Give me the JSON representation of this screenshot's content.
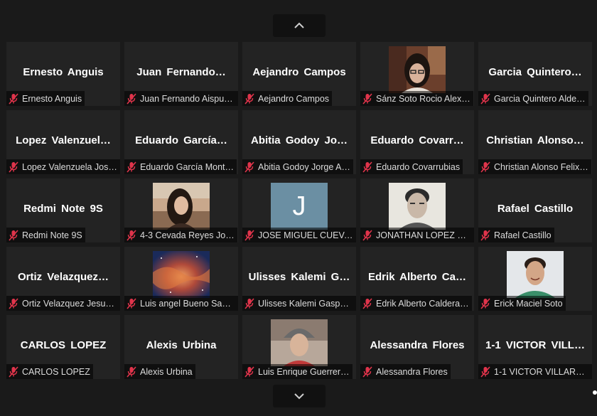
{
  "nav": {
    "up_icon": "chevron-up-icon",
    "down_icon": "chevron-down-icon"
  },
  "colors": {
    "background": "#1a1a1a",
    "tile": "#232323",
    "muted_mic": "#e0344b",
    "avatar_j": "#6b8fa3"
  },
  "participants": [
    {
      "tile": "Ernesto Anguis",
      "label": "Ernesto Anguis",
      "video": null
    },
    {
      "tile": "Juan  Fernando…",
      "label": "Juan Fernando Aispur…",
      "video": null
    },
    {
      "tile": "Aejandro Campos",
      "label": "Aejandro Campos",
      "video": null
    },
    {
      "tile": "",
      "label": "Sánz Soto Rocio Alex…",
      "video": "girl-glasses"
    },
    {
      "tile": "Garcia  Quintero…",
      "label": "Garcia Quintero Alde…",
      "video": null
    },
    {
      "tile": "Lopez  Valenzuel…",
      "label": "Lopez Valenzuela Jos…",
      "video": null
    },
    {
      "tile": "Eduardo  García…",
      "label": "Eduardo García Mont…",
      "video": null
    },
    {
      "tile": "Abitia  Godoy  Jo…",
      "label": "Abitia Godoy Jorge A…",
      "video": null
    },
    {
      "tile": "Eduardo  Covarr…",
      "label": "Eduardo Covarrubias",
      "video": null
    },
    {
      "tile": "Christian  Alonso…",
      "label": "Christian Alonso Felix…",
      "video": null
    },
    {
      "tile": "Redmi Note 9S",
      "label": "Redmi Note 9S",
      "video": null
    },
    {
      "tile": "",
      "label": "4-3 Cevada Reyes Jo…",
      "video": "girl-outdoor"
    },
    {
      "tile": "",
      "label": "JOSE MIGUEL CUEVA…",
      "video": "avatar-j",
      "avatar_letter": "J"
    },
    {
      "tile": "",
      "label": "JONATHAN LOPEZ M…",
      "video": "boy-bw"
    },
    {
      "tile": "Rafael Castillo",
      "label": "Rafael Castillo",
      "video": null
    },
    {
      "tile": "Ortiz  Velazquez…",
      "label": "Ortiz Velazquez Jesus…",
      "video": null
    },
    {
      "tile": "",
      "label": "Luis angel Bueno San…",
      "video": "nebula"
    },
    {
      "tile": "Ulisses  Kalemi  G…",
      "label": "Ulisses Kalemi Gaspa…",
      "video": null
    },
    {
      "tile": "Edrik  Alberto  Ca…",
      "label": "Edrik Alberto Caldera…",
      "video": null
    },
    {
      "tile": "",
      "label": "Erick Maciel Soto",
      "video": "boy-smile"
    },
    {
      "tile": "CARLOS LOPEZ",
      "label": "CARLOS LOPEZ",
      "video": null
    },
    {
      "tile": "Alexis Urbina",
      "label": "Alexis Urbina",
      "video": null
    },
    {
      "tile": "",
      "label": "Luis Enrique Guerrer…",
      "video": "boy-cap"
    },
    {
      "tile": "Alessandra Flores",
      "label": "Alessandra Flores",
      "video": null
    },
    {
      "tile": "1-1  VICTOR  VILL…",
      "label": "1-1 VICTOR VILLARRE…",
      "video": null
    }
  ]
}
